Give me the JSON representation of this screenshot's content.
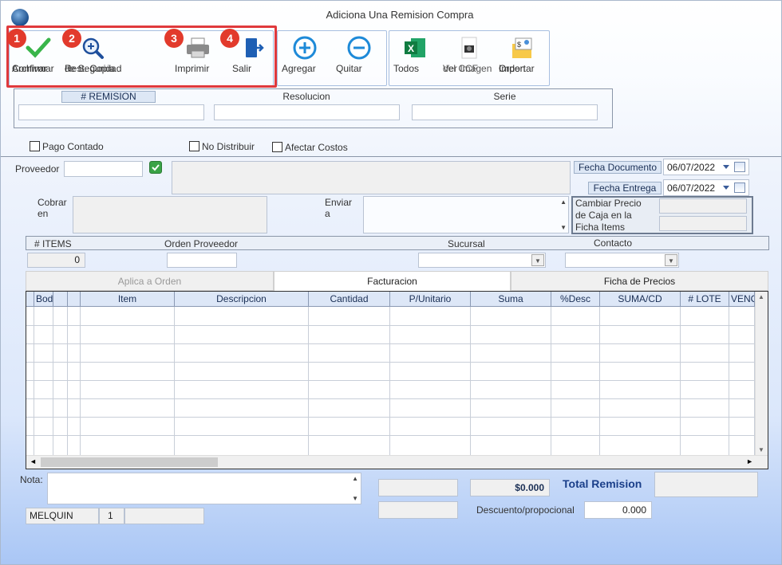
{
  "window": {
    "title": "Adiciona Una Remision Compra"
  },
  "toolbar": {
    "confirm": {
      "line1": "Confirmar",
      "line2": "Archivar"
    },
    "backup": {
      "line1": "Rest. Copia",
      "line2": "de Seguridad"
    },
    "print": "Imprimir",
    "exit": "Salir",
    "add": "Agregar",
    "remove": "Quitar",
    "excel": "Todos",
    "ccf": {
      "line1": "Ver Imagen",
      "line2": "del CCF"
    },
    "import": {
      "line1": "Importar",
      "line2": "Orden"
    }
  },
  "badges": [
    "1",
    "2",
    "3",
    "4"
  ],
  "header_box": {
    "remision_label": "# REMISION",
    "resolucion_label": "Resolucion",
    "serie_label": "Serie"
  },
  "checkboxes": {
    "pago_contado": "Pago Contado",
    "no_distribuir": "No Distribuir",
    "afectar_costos": "Afectar Costos"
  },
  "form": {
    "proveedor_label": "Proveedor",
    "fecha_documento_label": "Fecha Documento",
    "fecha_documento_value": "06/07/2022",
    "fecha_entrega_label": "Fecha Entrega",
    "fecha_entrega_value": "06/07/2022",
    "cobrar_label1": "Cobrar",
    "cobrar_label2": "en",
    "enviar_label1": "Enviar",
    "enviar_label2": "a",
    "cambiar_precio": {
      "line1": "Cambiar Precio",
      "line2": "de Caja en la",
      "line3": "Ficha Items"
    }
  },
  "info_bar": {
    "items_label": "# ITEMS",
    "items_value": "0",
    "orden_label": "Orden Proveedor",
    "sucursal_label": "Sucursal",
    "contacto_label": "Contacto"
  },
  "tabs": [
    "Aplica a Orden",
    "Facturacion",
    "Ficha de Precios"
  ],
  "grid": {
    "columns": [
      "",
      "Bodega",
      "",
      "",
      "Item",
      "Descripcion",
      "Cantidad",
      "P/Unitario",
      "Suma",
      "%Desc",
      "SUMA/CD",
      "# LOTE",
      "VENC"
    ]
  },
  "footer": {
    "nota_label": "Nota:",
    "total_amount": "$0.000",
    "total_label": "Total Remision",
    "descuento_label": "Descuento/propocional",
    "descuento_value": "0.000",
    "user": "MELQUIN",
    "user_num": "1"
  },
  "colors": {
    "accent": "#1a3f8a",
    "highlight": "#e0393c",
    "badge": "#e23a2c"
  }
}
